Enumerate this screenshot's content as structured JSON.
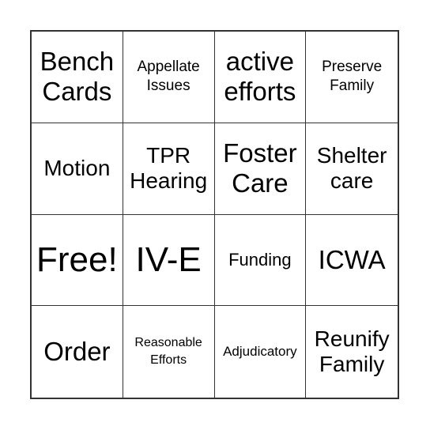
{
  "board": {
    "cells": [
      {
        "text": "Bench Cards",
        "size": "s-l"
      },
      {
        "text": "Appellate Issues",
        "size": "s-xs"
      },
      {
        "text": "active efforts",
        "size": "s-l"
      },
      {
        "text": "Preserve Family",
        "size": "s-xs"
      },
      {
        "text": "Motion",
        "size": "s-m"
      },
      {
        "text": "TPR Hearing",
        "size": "s-m"
      },
      {
        "text": "Foster Care",
        "size": "s-l"
      },
      {
        "text": "Shelter care",
        "size": "s-m"
      },
      {
        "text": "Free!",
        "size": "s-xl"
      },
      {
        "text": "IV-E",
        "size": "s-xl"
      },
      {
        "text": "Funding",
        "size": "s-s"
      },
      {
        "text": "ICWA",
        "size": "s-l"
      },
      {
        "text": "Order",
        "size": "s-l"
      },
      {
        "text": "Reasonable Efforts",
        "size": "s-xxs"
      },
      {
        "text": "Adjudicatory",
        "size": "s-tiny"
      },
      {
        "text": "Reunify Family",
        "size": "s-m"
      }
    ]
  }
}
